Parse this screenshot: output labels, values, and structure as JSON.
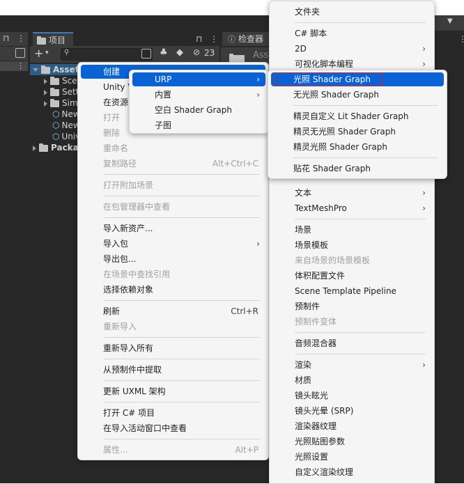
{
  "project_panel": {
    "tab_label": "项目",
    "inspector_tab_label": "检查器",
    "hidden_count": "23",
    "tree": [
      {
        "label": "Asset",
        "selected": true
      },
      {
        "label": "Scen"
      },
      {
        "label": "Setti"
      },
      {
        "label": "Simp"
      },
      {
        "label": "New"
      },
      {
        "label": "New"
      },
      {
        "label": "Univ"
      },
      {
        "label": "Packa"
      }
    ],
    "inspector_preview": "Ass"
  },
  "context_menu": {
    "items": [
      {
        "label": "创建",
        "highlighted": true
      },
      {
        "label": "Unity V"
      },
      {
        "label": "在资源"
      },
      {
        "label": "打开",
        "disabled": true
      },
      {
        "label": "删除",
        "disabled": true
      },
      {
        "label": "重命名",
        "disabled": true
      },
      {
        "label": "复制路径",
        "disabled": true,
        "shortcut": "Alt+Ctrl+C"
      },
      {
        "label": "打开附加场景",
        "disabled": true
      },
      {
        "label": "在包管理器中查看",
        "disabled": true
      },
      {
        "label": "导入新资产..."
      },
      {
        "label": "导入包"
      },
      {
        "label": "导出包..."
      },
      {
        "label": "在场景中查找引用",
        "disabled": true
      },
      {
        "label": "选择依赖对象"
      },
      {
        "label": "刷新",
        "shortcut": "Ctrl+R"
      },
      {
        "label": "重新导入",
        "disabled": true
      },
      {
        "label": "重新导入所有"
      },
      {
        "label": "从预制件中提取"
      },
      {
        "label": "更新 UXML 架构"
      },
      {
        "label": "打开 C# 项目"
      },
      {
        "label": "在导入活动窗口中查看"
      },
      {
        "label": "属性...",
        "disabled": true,
        "shortcut": "Alt+P"
      }
    ]
  },
  "urp_menu": {
    "items": [
      {
        "label": "URP",
        "highlighted": true
      },
      {
        "label": "内置"
      },
      {
        "label": "空白 Shader Graph"
      },
      {
        "label": "子图"
      }
    ]
  },
  "shader_menu": {
    "items": [
      {
        "label": "光照 Shader Graph",
        "highlighted": true
      },
      {
        "label": "无光照 Shader Graph"
      },
      {
        "label": "精灵自定义 Lit Shader Graph"
      },
      {
        "label": "精灵无光照 Shader Graph"
      },
      {
        "label": "精灵光照 Shader Graph"
      },
      {
        "label": "贴花 Shader Graph"
      }
    ]
  },
  "create_menu": {
    "items": [
      {
        "label": "文件夹"
      },
      {
        "label": "C# 脚本"
      },
      {
        "label": "2D"
      },
      {
        "label": "可视化脚本编程"
      },
      {
        "label": "文本"
      },
      {
        "label": "TextMeshPro"
      },
      {
        "label": "场景"
      },
      {
        "label": "场景模板"
      },
      {
        "label": "来自场景的场景模板",
        "disabled": true
      },
      {
        "label": "体积配置文件"
      },
      {
        "label": "Scene Template Pipeline"
      },
      {
        "label": "预制件"
      },
      {
        "label": "预制件变体",
        "disabled": true
      },
      {
        "label": "音频混合器"
      },
      {
        "label": "渲染"
      },
      {
        "label": "材质"
      },
      {
        "label": "镜头眩光"
      },
      {
        "label": "镜头光晕 (SRP)"
      },
      {
        "label": "渲染器纹理"
      },
      {
        "label": "光照贴图参数"
      },
      {
        "label": "光照设置"
      },
      {
        "label": "自定义渲染纹理"
      }
    ]
  },
  "colors": {
    "highlight": "#0a63d6",
    "menu_bg": "#f5f5f5",
    "editor_bg": "#282828",
    "annotation": "#e02020"
  }
}
